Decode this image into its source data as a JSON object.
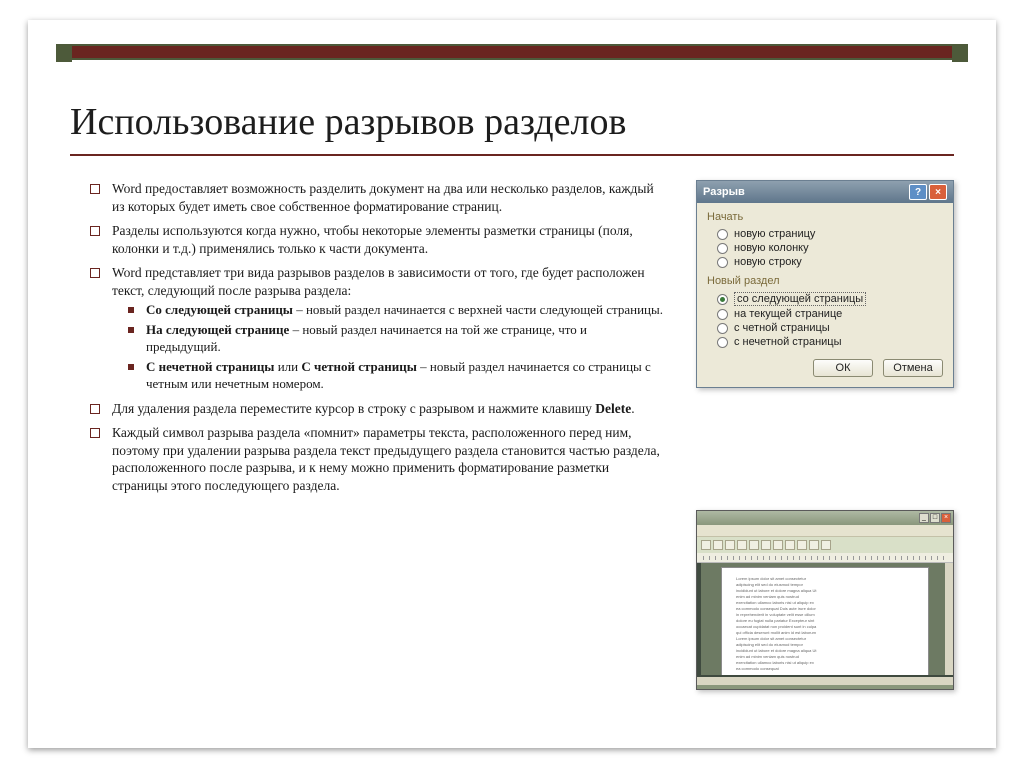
{
  "title": "Использование разрывов разделов",
  "bullets": {
    "b1": "Word предоставляет возможность разделить документ на два или несколько разделов, каждый из которых будет иметь свое собственное форматирование страниц.",
    "b2": "Разделы используются когда нужно, чтобы некоторые элементы разметки страницы (поля, колонки и т.д.) применялись только к части документа.",
    "b3": "Word представляет три вида разрывов разделов в зависимости от того, где будет расположен текст, следующий после разрыва раздела:",
    "b3a_bold": "Со следующей страницы",
    "b3a_rest": " – новый раздел начинается с верхней части следующей страницы.",
    "b3b_bold": "На следующей странице",
    "b3b_rest": " – новый раздел начинается на той же странице, что и предыдущий.",
    "b3c_bold1": "С нечетной страницы",
    "b3c_mid": " или ",
    "b3c_bold2": "С четной страницы",
    "b3c_rest": " – новый раздел начинается со страницы с четным или нечетным номером.",
    "b4_pre": "Для удаления раздела переместите курсор в строку с разрывом и нажмите клавишу ",
    "b4_bold": "Delete",
    "b4_post": ".",
    "b5": "Каждый символ разрыва раздела «помнит» параметры текста, расположенного перед ним, поэтому при удалении разрыва раздела текст предыдущего раздела становится частью раздела, расположенного после разрыва, и к нему можно применить форматирование разметки страницы этого последующего раздела."
  },
  "dialog": {
    "title": "Разрыв",
    "help": "?",
    "close": "×",
    "group1": "Начать",
    "r1": "новую страницу",
    "r2": "новую колонку",
    "r3": "новую строку",
    "group2": "Новый раздел",
    "r4": "со следующей страницы",
    "r5": "на текущей странице",
    "r6": "с четной страницы",
    "r7": "с нечетной страницы",
    "ok": "ОК",
    "cancel": "Отмена"
  },
  "word_thumb": {
    "min": "_",
    "max": "□",
    "close": "×",
    "filler": "Lorem ipsum dolor sit amet consectetur adipiscing elit sed do eiusmod tempor incididunt ut labore et dolore magna aliqua Ut enim ad minim veniam quis nostrud exercitation ullamco laboris nisi ut aliquip ex ea commodo consequat Duis aute irure dolor in reprehenderit in voluptate velit esse cillum dolore eu fugiat nulla pariatur Excepteur sint occaecat cupidatat non proident sunt in culpa qui officia deserunt mollit anim id est laborum Lorem ipsum dolor sit amet consectetur adipiscing elit sed do eiusmod tempor incididunt ut labore et dolore magna aliqua Ut enim ad minim veniam quis nostrud exercitation ullamco laboris nisi ut aliquip ex ea commodo consequat"
  }
}
